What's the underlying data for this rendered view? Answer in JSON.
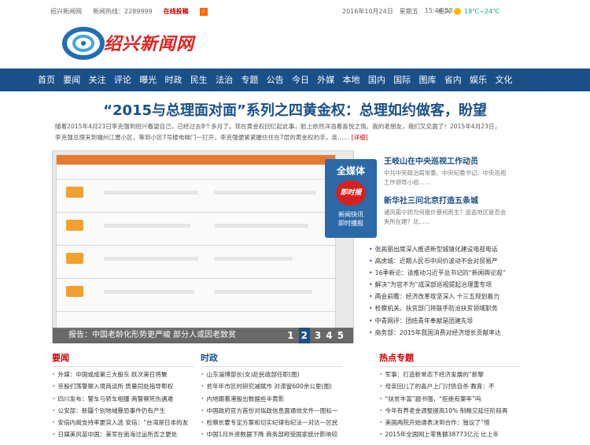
{
  "topbar": {
    "site": "绍兴新闻网",
    "hotline": "新闻热线：2289999",
    "submit": "在线投稿",
    "date": "2016年10月24日",
    "weekday": "星期五",
    "time": "15:44:53",
    "city": "绍兴",
    "temp": "18℃~24℃"
  },
  "logo": {
    "text": "绍兴新闻网"
  },
  "nav": [
    "首页",
    "要闻",
    "关注",
    "评论",
    "曝光",
    "时政",
    "民生",
    "法治",
    "专题",
    "公告",
    "今日",
    "外媒",
    "本地",
    "国内",
    "国际",
    "图库",
    "省内",
    "娱乐",
    "文化"
  ],
  "headline": "“2015与总理面对面”系列之四黄金权：总理如约做客，盼望",
  "lead": {
    "text": "随着2015年4月23日李克强到绍兴看望自己，已经过去8个多月了。现在黄金权回忆起此事，脸上依然洋溢着喜悦之情。我的老朋友，我们又见面了！2015年4月23日，李克强总理来到福州江厝小区，等到小区7号楼电梯门一打开，李克强便紧紧握住住在7层的黄金权的手，亲……",
    "more": "[详细]"
  },
  "slider": {
    "caption": "报告：中国老龄化形势更严峻 部分人或因老致贫",
    "pages": [
      "1",
      "2",
      "3",
      "4",
      "5"
    ],
    "active": "2"
  },
  "media": {
    "title": "全媒体",
    "badge": "即时报",
    "sub": "新闻快讯\n即时播报"
  },
  "side": {
    "h1": "王岐山在中央巡视工作动员",
    "p1": "中共中央政治局常委、中央纪委书记、中央巡视工作领导小组……",
    "h2": "新华社三问北京打造五条城",
    "p2": "诸风霜宁则为何报价暴何而生？追逃地区是否会失所在建？北……"
  },
  "sidelist": [
    "张高丽出席深入推进新型城镇化建设电视电话",
    "高虎城：近期人民币中间价波动不会对贸易产",
    "16季新论：谈推动习近平总书记的“新闻舆论观”",
    "解决“为官不为”成深部巡视提起治理重专项",
    "两会前瞻：经济改革攻坚深入 十三五规划着力",
    "检察机关、扶贫部门将联手防治扶贫领域职务",
    "中青网评：团结青年奉献是团建先导",
    "商务部：2015年我国消费对经济增长贡献率达"
  ],
  "col1": {
    "title": "要闻",
    "items": [
      "外媒：中国或成第三大股东 跃次美日将聚",
      "京股们荡警察入境商谈所 质量同处指导帮权",
      "四川发布：警车与轿车相撞 两警察死伤遇难",
      "公安部：新疆个别地域暴恐事件仍有产生",
      "安倍内阁支持率更突入选 安倍：“台湾是日本的友",
      "日媒美风苗中国：美军在南海过运所否之更处"
    ]
  },
  "col2": {
    "title": "时政",
    "items": [
      "山东淄博部长(女)赴民政部任职(图)",
      "贫年年市区时研究减赋市 对滞留600余公里(图)",
      "内地跟着港股出数据些半黄影",
      "中国政府官方首份对拟政信息面通效文件一图标一",
      "检察长要专定方案和切实纪律有纪法一对达一区民",
      "中国1月外资数据下降 商务部称受国家统计影响较"
    ]
  },
  "col3": {
    "title": "热点专题",
    "items": [
      "军事：打造新常态下经济发展的“新擎",
      "母亲回儿了的喜户上门讨债自杀 教育：不",
      "“扶贫丰富”题书强，“拒绝有案率”吗",
      "今年有养老金调整提高10% 制粮交延任阶段再",
      "美国两院开始通表决到合作：独议了“惜",
      "2015年全国网上零售额38773亿元 比上年"
    ]
  }
}
